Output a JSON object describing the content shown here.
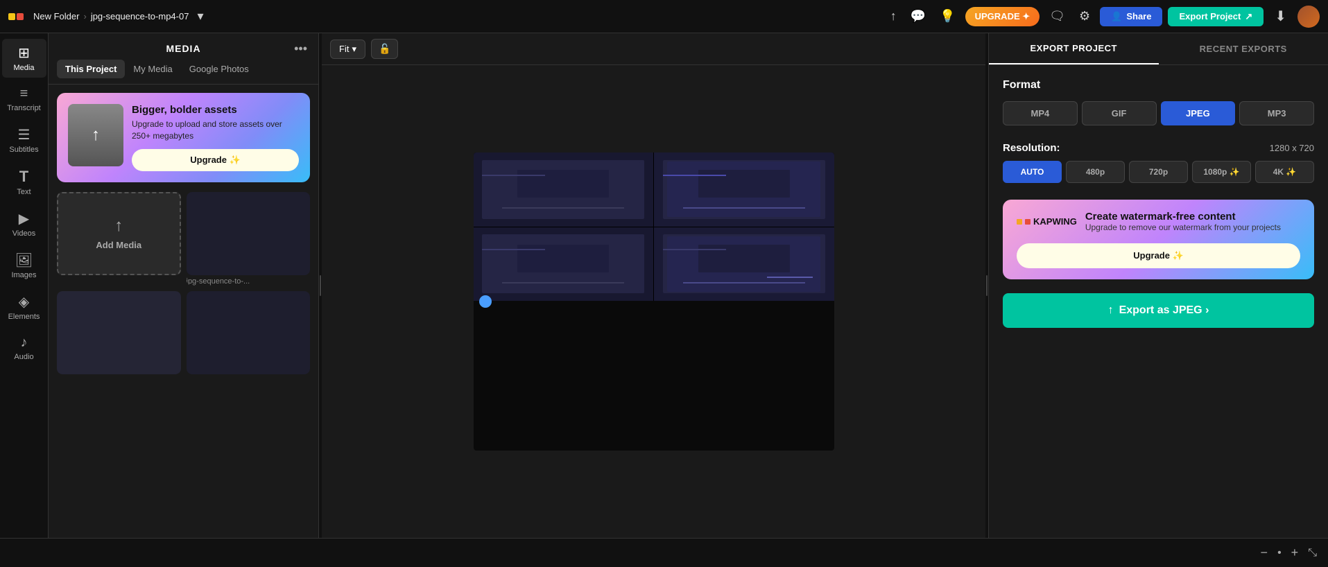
{
  "topbar": {
    "folder": "New Folder",
    "separator": "›",
    "project": "jpg-sequence-to-mp4-07",
    "upgrade_label": "UPGRADE ✦",
    "share_label": "Share",
    "export_project_label": "Export Project",
    "icons": {
      "chevron": "▾",
      "upload": "↑",
      "chat": "💬",
      "settings": "⚙",
      "download": "⬇"
    }
  },
  "left_sidebar": {
    "items": [
      {
        "id": "media",
        "label": "Media",
        "icon": "⊞",
        "active": true
      },
      {
        "id": "transcript",
        "label": "Transcript",
        "icon": "≡"
      },
      {
        "id": "subtitles",
        "label": "Subtitles",
        "icon": "☰"
      },
      {
        "id": "text",
        "label": "Text",
        "icon": "T"
      },
      {
        "id": "videos",
        "label": "Videos",
        "icon": "▶"
      },
      {
        "id": "images",
        "label": "Images",
        "icon": "🖼"
      },
      {
        "id": "elements",
        "label": "Elements",
        "icon": "◈"
      },
      {
        "id": "audio",
        "label": "Audio",
        "icon": "♪"
      }
    ]
  },
  "media_panel": {
    "title": "MEDIA",
    "tabs": [
      {
        "id": "this_project",
        "label": "This Project",
        "active": true
      },
      {
        "id": "my_media",
        "label": "My Media"
      },
      {
        "id": "google_photos",
        "label": "Google Photos"
      }
    ],
    "upgrade_card": {
      "title": "Bigger, bolder assets",
      "description": "Upgrade to upload and store assets over 250+ megabytes",
      "button": "Upgrade ✨"
    },
    "add_media_label": "Add Media",
    "file_label": "jpg-sequence-to-..."
  },
  "preview": {
    "fit_label": "Fit",
    "fit_chevron": "▾",
    "lock_icon": "🔓"
  },
  "export_panel": {
    "tabs": [
      {
        "id": "export_project",
        "label": "EXPORT PROJECT",
        "active": true
      },
      {
        "id": "recent_exports",
        "label": "RECENT EXPORTS"
      }
    ],
    "format_label": "Format",
    "formats": [
      {
        "id": "mp4",
        "label": "MP4"
      },
      {
        "id": "gif",
        "label": "GIF"
      },
      {
        "id": "jpeg",
        "label": "JPEG",
        "active": true
      },
      {
        "id": "mp3",
        "label": "MP3"
      }
    ],
    "resolution_label": "Resolution:",
    "resolution_value": "1280 x 720",
    "resolutions": [
      {
        "id": "auto",
        "label": "AUTO",
        "active": true
      },
      {
        "id": "480p",
        "label": "480p"
      },
      {
        "id": "720p",
        "label": "720p"
      },
      {
        "id": "1080p",
        "label": "1080p ✨"
      },
      {
        "id": "4k",
        "label": "4K ✨"
      }
    ],
    "upgrade_banner": {
      "logo_text": "KAPWING",
      "title": "Create watermark-free content",
      "description": "Upgrade to remove our watermark from your projects",
      "button": "Upgrade ✨"
    },
    "export_button": "Export as JPEG  ›"
  },
  "zoom": {
    "minus": "−",
    "dot": "•",
    "plus": "+"
  }
}
